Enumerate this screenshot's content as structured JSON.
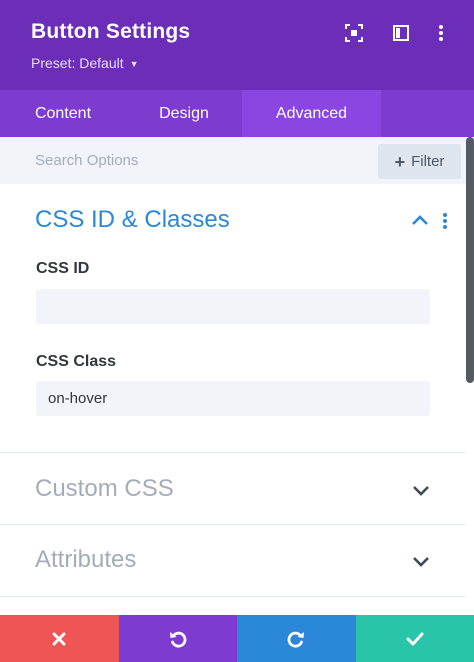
{
  "header": {
    "title": "Button Settings",
    "preset_label": "Preset: Default",
    "icons": [
      "focus-icon",
      "split-view-icon",
      "more-vertical-icon"
    ],
    "color": "#6c2eb9"
  },
  "tabs": [
    {
      "label": "Content",
      "active": false
    },
    {
      "label": "Design",
      "active": false
    },
    {
      "label": "Advanced",
      "active": true
    }
  ],
  "search": {
    "placeholder": "Search Options",
    "filter_label": "Filter"
  },
  "sections": {
    "css_id_classes": {
      "title": "CSS ID & Classes",
      "expanded": true,
      "fields": {
        "css_id": {
          "label": "CSS ID",
          "value": ""
        },
        "css_class": {
          "label": "CSS Class",
          "value": "on-hover"
        }
      }
    },
    "custom_css": {
      "title": "Custom CSS",
      "expanded": false
    },
    "attributes": {
      "title": "Attributes",
      "expanded": false
    }
  },
  "footer": {
    "buttons": [
      {
        "name": "discard",
        "icon": "close-icon",
        "color": "#ef5555"
      },
      {
        "name": "undo",
        "icon": "undo-icon",
        "color": "#7e3bd0"
      },
      {
        "name": "redo",
        "icon": "redo-icon",
        "color": "#2b87da"
      },
      {
        "name": "save",
        "icon": "check-icon",
        "color": "#29c4a9"
      }
    ]
  }
}
